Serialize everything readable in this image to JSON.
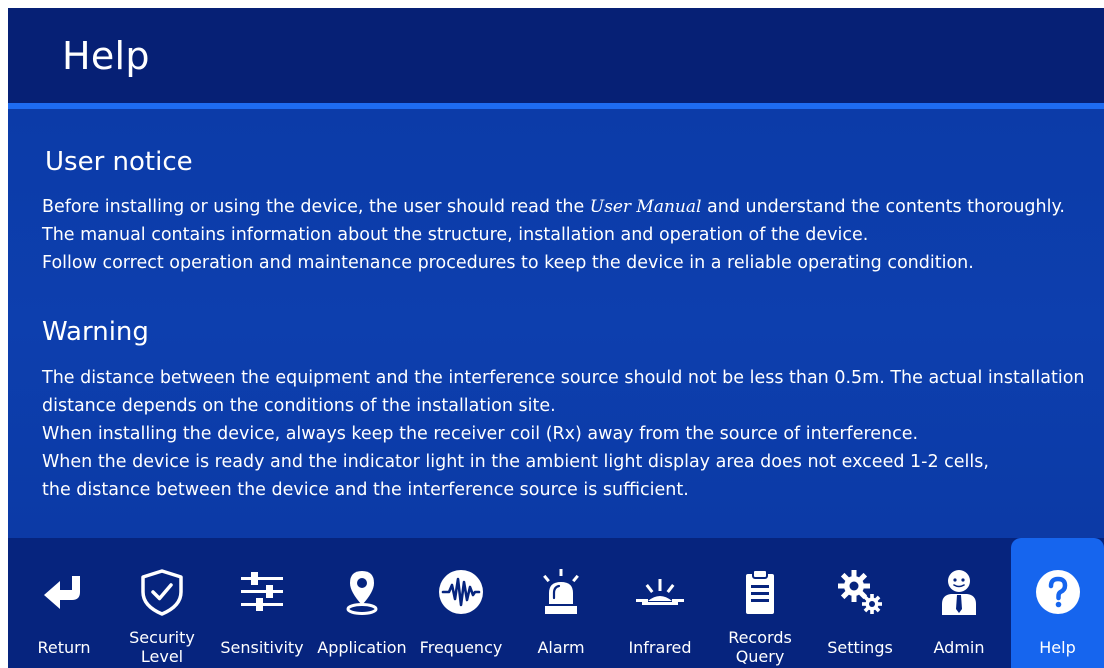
{
  "header": {
    "title": "Help"
  },
  "user_notice": {
    "heading": "User notice",
    "line1_before": "Before installing or using the device, the user should read the ",
    "line1_italic": "User Manual",
    "line1_after": " and understand the contents thoroughly.",
    "line2": "The manual contains information about the structure, installation and operation of the device.",
    "line3": "Follow correct operation and maintenance procedures to keep the device in a reliable operating condition."
  },
  "warning": {
    "heading": "Warning",
    "line1": "The distance between the equipment and the interference source should not be less than 0.5m. The actual installation",
    "line2": "distance depends on the conditions of the installation site.",
    "line3": "When installing the device, always keep the receiver coil (Rx) away from the source of interference.",
    "line4": "When the device is ready and the indicator light in the ambient light display area does not exceed 1-2 cells,",
    "line5": "the distance between the device and the interference source is sufficient."
  },
  "nav": {
    "items": [
      {
        "label": "Return",
        "icon": "return-arrow-icon"
      },
      {
        "label": "Security",
        "label2": "Level",
        "icon": "shield-check-icon"
      },
      {
        "label": "Sensitivity",
        "icon": "sliders-icon"
      },
      {
        "label": "Application",
        "icon": "location-pin-icon"
      },
      {
        "label": "Frequency",
        "icon": "waveform-icon"
      },
      {
        "label": "Alarm",
        "icon": "alarm-light-icon"
      },
      {
        "label": "Infrared",
        "icon": "infrared-icon"
      },
      {
        "label": "Records",
        "label2": "Query",
        "icon": "clipboard-icon"
      },
      {
        "label": "Settings",
        "icon": "gears-icon"
      },
      {
        "label": "Admin",
        "icon": "admin-user-icon"
      },
      {
        "label": "Help",
        "icon": "question-icon",
        "active": true
      }
    ]
  },
  "colors": {
    "header_bg": "#062075",
    "content_bg": "#0c3aa6",
    "accent_line": "#1e6cf2",
    "nav_bg": "#06247e",
    "nav_active": "#1665ee",
    "text": "#ffffff"
  }
}
